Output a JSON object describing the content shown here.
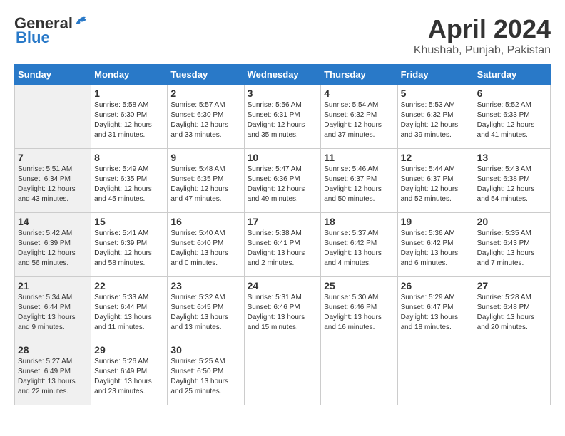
{
  "header": {
    "logo_line1": "General",
    "logo_line2": "Blue",
    "month": "April 2024",
    "location": "Khushab, Punjab, Pakistan"
  },
  "days_of_week": [
    "Sunday",
    "Monday",
    "Tuesday",
    "Wednesday",
    "Thursday",
    "Friday",
    "Saturday"
  ],
  "weeks": [
    [
      {
        "day": "",
        "info": ""
      },
      {
        "day": "1",
        "info": "Sunrise: 5:58 AM\nSunset: 6:30 PM\nDaylight: 12 hours\nand 31 minutes."
      },
      {
        "day": "2",
        "info": "Sunrise: 5:57 AM\nSunset: 6:30 PM\nDaylight: 12 hours\nand 33 minutes."
      },
      {
        "day": "3",
        "info": "Sunrise: 5:56 AM\nSunset: 6:31 PM\nDaylight: 12 hours\nand 35 minutes."
      },
      {
        "day": "4",
        "info": "Sunrise: 5:54 AM\nSunset: 6:32 PM\nDaylight: 12 hours\nand 37 minutes."
      },
      {
        "day": "5",
        "info": "Sunrise: 5:53 AM\nSunset: 6:32 PM\nDaylight: 12 hours\nand 39 minutes."
      },
      {
        "day": "6",
        "info": "Sunrise: 5:52 AM\nSunset: 6:33 PM\nDaylight: 12 hours\nand 41 minutes."
      }
    ],
    [
      {
        "day": "7",
        "info": "Sunrise: 5:51 AM\nSunset: 6:34 PM\nDaylight: 12 hours\nand 43 minutes."
      },
      {
        "day": "8",
        "info": "Sunrise: 5:49 AM\nSunset: 6:35 PM\nDaylight: 12 hours\nand 45 minutes."
      },
      {
        "day": "9",
        "info": "Sunrise: 5:48 AM\nSunset: 6:35 PM\nDaylight: 12 hours\nand 47 minutes."
      },
      {
        "day": "10",
        "info": "Sunrise: 5:47 AM\nSunset: 6:36 PM\nDaylight: 12 hours\nand 49 minutes."
      },
      {
        "day": "11",
        "info": "Sunrise: 5:46 AM\nSunset: 6:37 PM\nDaylight: 12 hours\nand 50 minutes."
      },
      {
        "day": "12",
        "info": "Sunrise: 5:44 AM\nSunset: 6:37 PM\nDaylight: 12 hours\nand 52 minutes."
      },
      {
        "day": "13",
        "info": "Sunrise: 5:43 AM\nSunset: 6:38 PM\nDaylight: 12 hours\nand 54 minutes."
      }
    ],
    [
      {
        "day": "14",
        "info": "Sunrise: 5:42 AM\nSunset: 6:39 PM\nDaylight: 12 hours\nand 56 minutes."
      },
      {
        "day": "15",
        "info": "Sunrise: 5:41 AM\nSunset: 6:39 PM\nDaylight: 12 hours\nand 58 minutes."
      },
      {
        "day": "16",
        "info": "Sunrise: 5:40 AM\nSunset: 6:40 PM\nDaylight: 13 hours\nand 0 minutes."
      },
      {
        "day": "17",
        "info": "Sunrise: 5:38 AM\nSunset: 6:41 PM\nDaylight: 13 hours\nand 2 minutes."
      },
      {
        "day": "18",
        "info": "Sunrise: 5:37 AM\nSunset: 6:42 PM\nDaylight: 13 hours\nand 4 minutes."
      },
      {
        "day": "19",
        "info": "Sunrise: 5:36 AM\nSunset: 6:42 PM\nDaylight: 13 hours\nand 6 minutes."
      },
      {
        "day": "20",
        "info": "Sunrise: 5:35 AM\nSunset: 6:43 PM\nDaylight: 13 hours\nand 7 minutes."
      }
    ],
    [
      {
        "day": "21",
        "info": "Sunrise: 5:34 AM\nSunset: 6:44 PM\nDaylight: 13 hours\nand 9 minutes."
      },
      {
        "day": "22",
        "info": "Sunrise: 5:33 AM\nSunset: 6:44 PM\nDaylight: 13 hours\nand 11 minutes."
      },
      {
        "day": "23",
        "info": "Sunrise: 5:32 AM\nSunset: 6:45 PM\nDaylight: 13 hours\nand 13 minutes."
      },
      {
        "day": "24",
        "info": "Sunrise: 5:31 AM\nSunset: 6:46 PM\nDaylight: 13 hours\nand 15 minutes."
      },
      {
        "day": "25",
        "info": "Sunrise: 5:30 AM\nSunset: 6:46 PM\nDaylight: 13 hours\nand 16 minutes."
      },
      {
        "day": "26",
        "info": "Sunrise: 5:29 AM\nSunset: 6:47 PM\nDaylight: 13 hours\nand 18 minutes."
      },
      {
        "day": "27",
        "info": "Sunrise: 5:28 AM\nSunset: 6:48 PM\nDaylight: 13 hours\nand 20 minutes."
      }
    ],
    [
      {
        "day": "28",
        "info": "Sunrise: 5:27 AM\nSunset: 6:49 PM\nDaylight: 13 hours\nand 22 minutes."
      },
      {
        "day": "29",
        "info": "Sunrise: 5:26 AM\nSunset: 6:49 PM\nDaylight: 13 hours\nand 23 minutes."
      },
      {
        "day": "30",
        "info": "Sunrise: 5:25 AM\nSunset: 6:50 PM\nDaylight: 13 hours\nand 25 minutes."
      },
      {
        "day": "",
        "info": ""
      },
      {
        "day": "",
        "info": ""
      },
      {
        "day": "",
        "info": ""
      },
      {
        "day": "",
        "info": ""
      }
    ]
  ]
}
